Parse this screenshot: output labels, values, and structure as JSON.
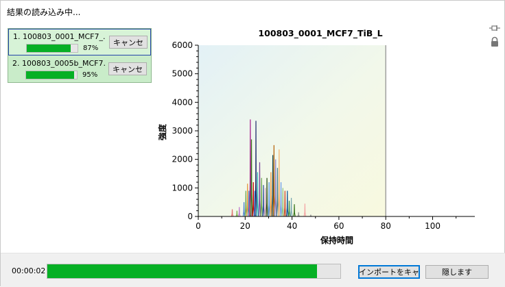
{
  "window": {
    "title": "結果の読み込み中..."
  },
  "icons": {
    "pin": "pin-icon",
    "lock": "lock-icon"
  },
  "queue": {
    "items": [
      {
        "label": "1. 100803_0001_MCF7_...",
        "progress": 87,
        "progress_text": "87%",
        "cancel": "キャンセ"
      },
      {
        "label": "2. 100803_0005b_MCF7...",
        "progress": 95,
        "progress_text": "95%",
        "cancel": "キャンセ"
      }
    ]
  },
  "chart_data": {
    "type": "line",
    "title": "100803_0001_MCF7_TiB_L",
    "xlabel": "保持時間",
    "ylabel": "強度",
    "xlim": [
      0,
      118
    ],
    "ylim": [
      0,
      6000
    ],
    "xticks": [
      0,
      20,
      40,
      60,
      80,
      100
    ],
    "yticks": [
      0,
      1000,
      2000,
      3000,
      4000,
      5000,
      6000
    ],
    "loaded_until": 80,
    "grid": false,
    "peaks": [
      {
        "x": 14.5,
        "y": 250,
        "color": "#e07070"
      },
      {
        "x": 16.5,
        "y": 200,
        "color": "#7ab04c"
      },
      {
        "x": 17.5,
        "y": 330,
        "color": "#c07bd0"
      },
      {
        "x": 19.5,
        "y": 500,
        "color": "#4a7fd0"
      },
      {
        "x": 20.3,
        "y": 900,
        "color": "#6aa84f"
      },
      {
        "x": 21.0,
        "y": 1150,
        "color": "#e69138"
      },
      {
        "x": 21.6,
        "y": 900,
        "color": "#3d85c6"
      },
      {
        "x": 22.2,
        "y": 3400,
        "color": "#a61c8a"
      },
      {
        "x": 22.7,
        "y": 2700,
        "color": "#38761d"
      },
      {
        "x": 23.5,
        "y": 1200,
        "color": "#cc0000"
      },
      {
        "x": 24.1,
        "y": 900,
        "color": "#3c78d8"
      },
      {
        "x": 24.6,
        "y": 3350,
        "color": "#1f2a6b"
      },
      {
        "x": 25.3,
        "y": 1550,
        "color": "#2bb5b5"
      },
      {
        "x": 26.2,
        "y": 1900,
        "color": "#7b3f99"
      },
      {
        "x": 27.0,
        "y": 1350,
        "color": "#6aa84f"
      },
      {
        "x": 27.8,
        "y": 1100,
        "color": "#2d4d9e"
      },
      {
        "x": 28.6,
        "y": 1000,
        "color": "#d5a6bd"
      },
      {
        "x": 29.3,
        "y": 1350,
        "color": "#274e13"
      },
      {
        "x": 30.2,
        "y": 1200,
        "color": "#4f8fe0"
      },
      {
        "x": 31.0,
        "y": 1550,
        "color": "#e69138"
      },
      {
        "x": 31.8,
        "y": 2150,
        "color": "#134f5c"
      },
      {
        "x": 32.3,
        "y": 2500,
        "color": "#b45f06"
      },
      {
        "x": 33.0,
        "y": 2000,
        "color": "#8e7cc3"
      },
      {
        "x": 33.8,
        "y": 1700,
        "color": "#45818e"
      },
      {
        "x": 34.5,
        "y": 2350,
        "color": "#f6b26b"
      },
      {
        "x": 35.3,
        "y": 1200,
        "color": "#6d9eeb"
      },
      {
        "x": 36.1,
        "y": 1000,
        "color": "#93c47d"
      },
      {
        "x": 37.0,
        "y": 900,
        "color": "#cc4125"
      },
      {
        "x": 38.0,
        "y": 900,
        "color": "#0b5394"
      },
      {
        "x": 38.8,
        "y": 550,
        "color": "#3e8e41"
      },
      {
        "x": 39.7,
        "y": 650,
        "color": "#76a5af"
      },
      {
        "x": 41.0,
        "y": 430,
        "color": "#38761d"
      },
      {
        "x": 42.8,
        "y": 150,
        "color": "#999999"
      },
      {
        "x": 45.5,
        "y": 450,
        "color": "#f4a6a6"
      },
      {
        "x": 48.0,
        "y": 60,
        "color": "#999999"
      }
    ]
  },
  "footer": {
    "elapsed": "00:00:02",
    "progress": 92,
    "import_cancel": "インポートをキャ",
    "hide": "隠します"
  }
}
